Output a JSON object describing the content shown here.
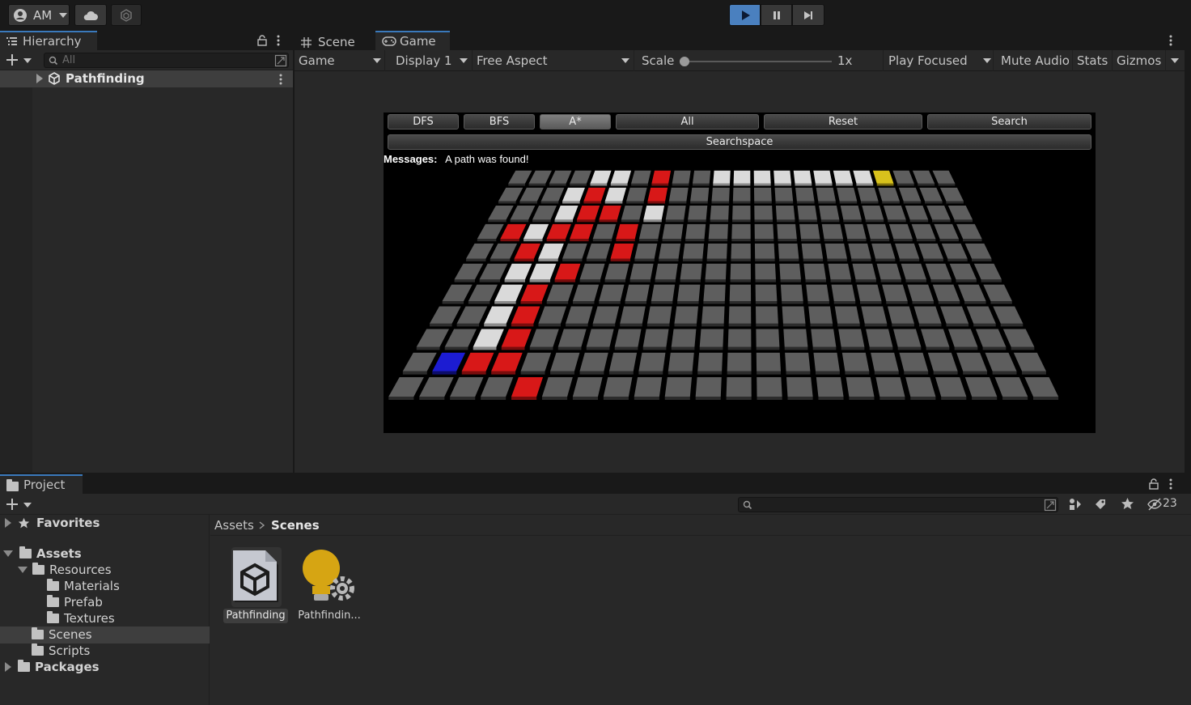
{
  "toolbar": {
    "account_label": "AM",
    "play_icon": "play-icon",
    "pause_icon": "pause-icon",
    "step_icon": "step-icon"
  },
  "hierarchy": {
    "tab_label": "Hierarchy",
    "search_placeholder": "All",
    "root_item": "Pathfinding"
  },
  "scene_tab": {
    "label": "Scene"
  },
  "game_tab": {
    "label": "Game"
  },
  "game_toolbar": {
    "view_mode": "Game",
    "display": "Display 1",
    "aspect": "Free Aspect",
    "scale_label": "Scale",
    "scale_value": "1x",
    "play_mode": "Play Focused",
    "mute": "Mute Audio",
    "stats": "Stats",
    "gizmos": "Gizmos"
  },
  "game_view": {
    "buttons": [
      "DFS",
      "BFS",
      "A*",
      "All",
      "Reset",
      "Search"
    ],
    "active_button": "A*",
    "searchspace_button": "Searchspace",
    "messages_label": "Messages:",
    "messages_text": "A path was found!",
    "grid": {
      "columns": 22,
      "rows": 11,
      "cell_states": [
        "....WW.R..WWWWWWWWY...",
        "...WRW.R..............",
        "...WRR.W..............",
        ".RWRR.R...............",
        "..RW..R...............",
        "..WWR.................",
        "..WR..................",
        "..WR..................",
        "..WR..................",
        ".BRR..................",
        "....R................."
      ],
      "legend": {
        ".": "empty",
        "W": "visited",
        "R": "path",
        "B": "start",
        "Y": "goal"
      },
      "colors": {
        "empty": "#5a5a5a",
        "visited": "#d4d4d4",
        "path": "#d41414",
        "start": "#1a1acc",
        "goal": "#d4c01a"
      }
    }
  },
  "project": {
    "tab_label": "Project",
    "hidden_count": "23",
    "tree": {
      "favorites": "Favorites",
      "assets": "Assets",
      "resources": "Resources",
      "materials": "Materials",
      "prefab": "Prefab",
      "textures": "Textures",
      "scenes": "Scenes",
      "scripts": "Scripts",
      "packages": "Packages"
    },
    "breadcrumb": {
      "root": "Assets",
      "current": "Scenes"
    },
    "assets": [
      {
        "label": "Pathfinding",
        "icon": "unity-scene-icon"
      },
      {
        "label": "Pathfindin...",
        "icon": "lighting-settings-icon"
      }
    ]
  }
}
